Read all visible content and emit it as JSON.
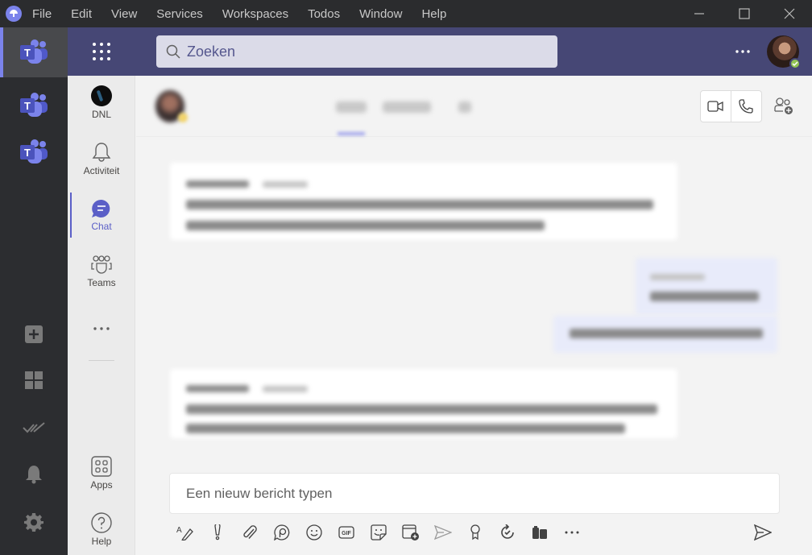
{
  "titlebar": {
    "menu": [
      "File",
      "Edit",
      "View",
      "Services",
      "Workspaces",
      "Todos",
      "Window",
      "Help"
    ],
    "controls": [
      "minimize",
      "maximize",
      "close"
    ]
  },
  "rail": {
    "workspaces": [
      {
        "name": "Microsoft Teams",
        "icon": "teams-icon",
        "active": true
      },
      {
        "name": "Microsoft Teams",
        "icon": "teams-icon",
        "active": false
      },
      {
        "name": "Microsoft Teams",
        "icon": "teams-icon",
        "active": false
      }
    ],
    "actions": [
      "add-service-icon",
      "workspaces-grid-icon",
      "todos-icon",
      "notifications-icon",
      "settings-icon"
    ]
  },
  "header": {
    "search_placeholder": "Zoeken",
    "more_label": "...",
    "presence": "available",
    "brand_color": "#464775"
  },
  "appbar": {
    "items": [
      {
        "label": "DNL",
        "icon": "dnl-logo"
      },
      {
        "label": "Activiteit",
        "icon": "bell-icon"
      },
      {
        "label": "Chat",
        "icon": "chat-icon",
        "active": true
      },
      {
        "label": "Teams",
        "icon": "teams-people-icon"
      },
      {
        "label": "...",
        "icon": "more-icon"
      }
    ],
    "bottom": [
      {
        "label": "Apps",
        "icon": "apps-icon"
      },
      {
        "label": "Help",
        "icon": "help-icon"
      }
    ],
    "accent_color": "#5b5fc7"
  },
  "chat": {
    "header_actions": [
      "video-call",
      "audio-call",
      "add-people"
    ],
    "messages_blurred": true,
    "composer_placeholder": "Een nieuw bericht typen",
    "toolbar": [
      "format",
      "important",
      "attach",
      "loop",
      "emoji",
      "gif",
      "sticker",
      "schedule-meeting",
      "stream",
      "praise",
      "updates",
      "apps",
      "more"
    ]
  }
}
